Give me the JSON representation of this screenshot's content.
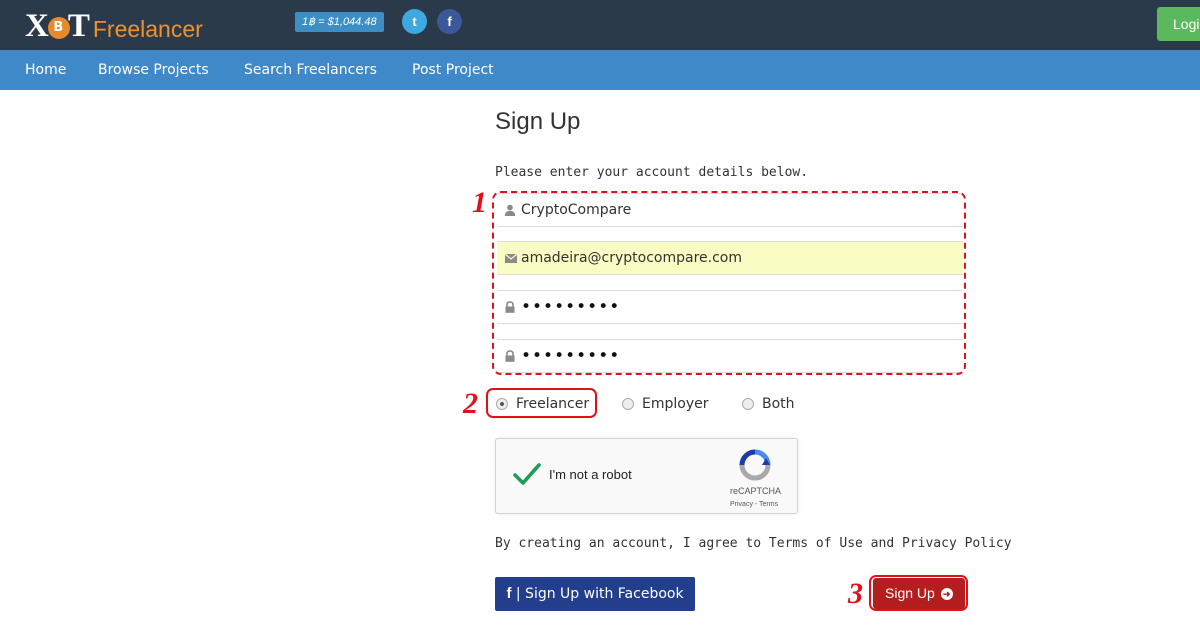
{
  "header": {
    "logo_mark": "XOT",
    "logo_coin": "B",
    "logo_word": "Freelancer",
    "price_badge": "1฿ = $1,044.48",
    "social": [
      {
        "name": "twitter-icon",
        "glyph": "t"
      },
      {
        "name": "facebook-icon",
        "glyph": "f"
      }
    ],
    "login_label": "Login",
    "colors": {
      "bar": "#2b3a4a",
      "accent": "#f0912e",
      "login": "#5cb85c"
    }
  },
  "nav": {
    "items": [
      {
        "label": "Home"
      },
      {
        "label": "Browse Projects"
      },
      {
        "label": "Search Freelancers"
      },
      {
        "label": "Post Project"
      }
    ],
    "color": "#3f89c9"
  },
  "form": {
    "title": "Sign Up",
    "intro": "Please enter your account details below.",
    "fields": [
      {
        "icon": "user-icon",
        "value": "CryptoCompare"
      },
      {
        "icon": "envelope-icon",
        "value": "amadeira@cryptocompare.com"
      },
      {
        "icon": "lock-icon",
        "value": "•••••••••"
      },
      {
        "icon": "lock-icon",
        "value": "•••••••••"
      }
    ],
    "roles": [
      {
        "label": "Freelancer",
        "selected": true
      },
      {
        "label": "Employer",
        "selected": false
      },
      {
        "label": "Both",
        "selected": false
      }
    ],
    "captcha": {
      "label": "I'm not a robot",
      "brand": "reCAPTCHA",
      "links": "Privacy - Terms"
    },
    "agreement": "By creating an account, I agree to Terms of Use and Privacy Policy",
    "facebook_button": {
      "icon": "f",
      "label": "| Sign Up with Facebook"
    },
    "submit_label": "Sign Up"
  },
  "annotations": {
    "steps": [
      "1",
      "2",
      "3"
    ],
    "color": "#e3101a"
  }
}
